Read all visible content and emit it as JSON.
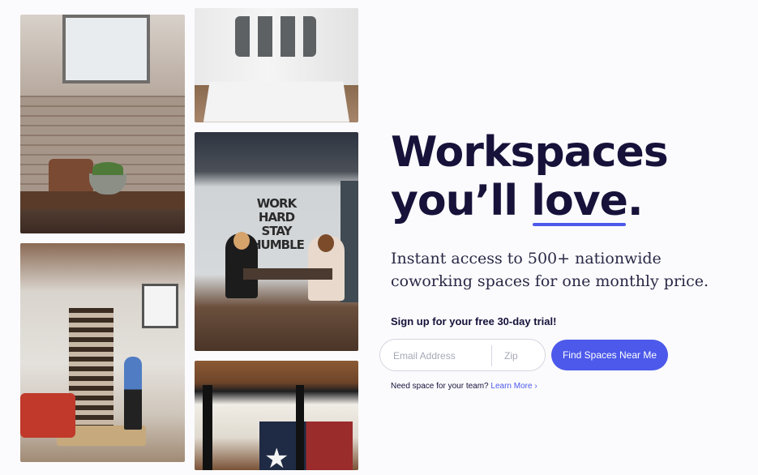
{
  "hero": {
    "headline_line1": "Workspaces",
    "headline_line2_prefix": "you’ll ",
    "headline_emphasis": "love",
    "headline_suffix": ".",
    "subheadline": "Instant access to 500+ nationwide coworking spaces for one monthly price.",
    "trial_cta": "Sign up for your free 30-day trial!"
  },
  "form": {
    "email_placeholder": "Email Address",
    "zip_placeholder": "Zip",
    "submit_label": "Find Spaces Near Me"
  },
  "team": {
    "text": "Need space for your team?",
    "link_label": "Learn More ›"
  },
  "photos": {
    "sign_text": "WORK HARD STAY HUMBLE"
  },
  "colors": {
    "accent": "#4c59ea",
    "ink": "#16123a",
    "background": "#fbfbfd"
  }
}
